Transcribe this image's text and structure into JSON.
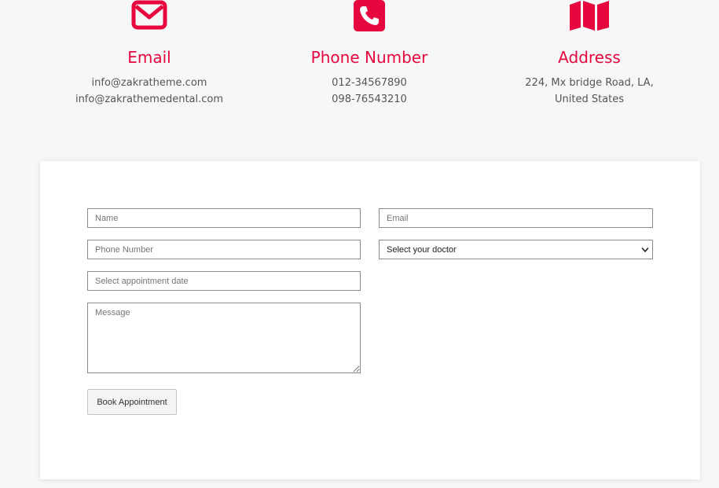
{
  "contact": {
    "email": {
      "icon": "envelope-icon",
      "title": "Email",
      "lines": [
        "info@zakratheme.com",
        "info@zakrathemedental.com"
      ]
    },
    "phone": {
      "icon": "phone-icon",
      "title": "Phone Number",
      "lines": [
        "012-34567890",
        "098-76543210"
      ]
    },
    "address": {
      "icon": "map-icon",
      "title": "Address",
      "lines": [
        "224, Mx bridge Road, LA,",
        "United States"
      ]
    },
    "accent_color": "#e6073f"
  },
  "form": {
    "name_placeholder": "Name",
    "email_placeholder": "Email",
    "phone_placeholder": "Phone Number",
    "doctor_selected": "Select your doctor",
    "date_placeholder": "Select appointment date",
    "message_placeholder": "Message",
    "submit_label": "Book Appointment"
  }
}
